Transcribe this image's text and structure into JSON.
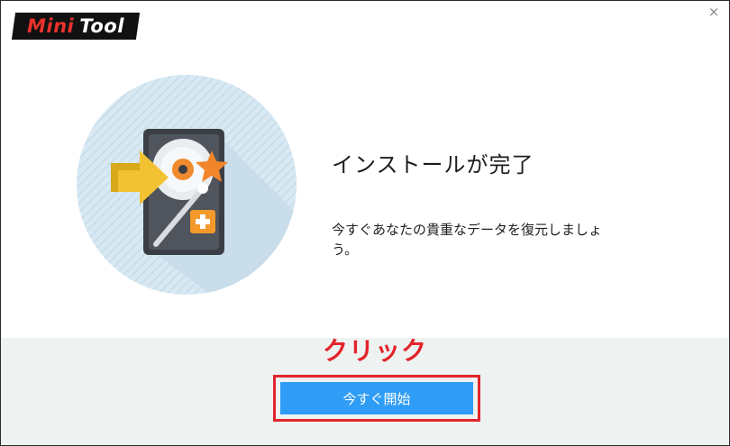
{
  "window": {
    "logo": {
      "part1": "Mini",
      "part2": "Tool"
    },
    "close_glyph": "×"
  },
  "main": {
    "heading": "インストールが完了",
    "description": "今すぐあなたの貴重なデータを復元しましょう。",
    "illustration_icon": "hard-drive-recovery-icon"
  },
  "footer": {
    "annotation": "クリック",
    "start_button": "今すぐ開始"
  },
  "colors": {
    "accent_button": "#2f9df6",
    "annotation_red": "#e3242b",
    "footer_bg": "#eef3f2",
    "brand_red": "#e8312c"
  }
}
